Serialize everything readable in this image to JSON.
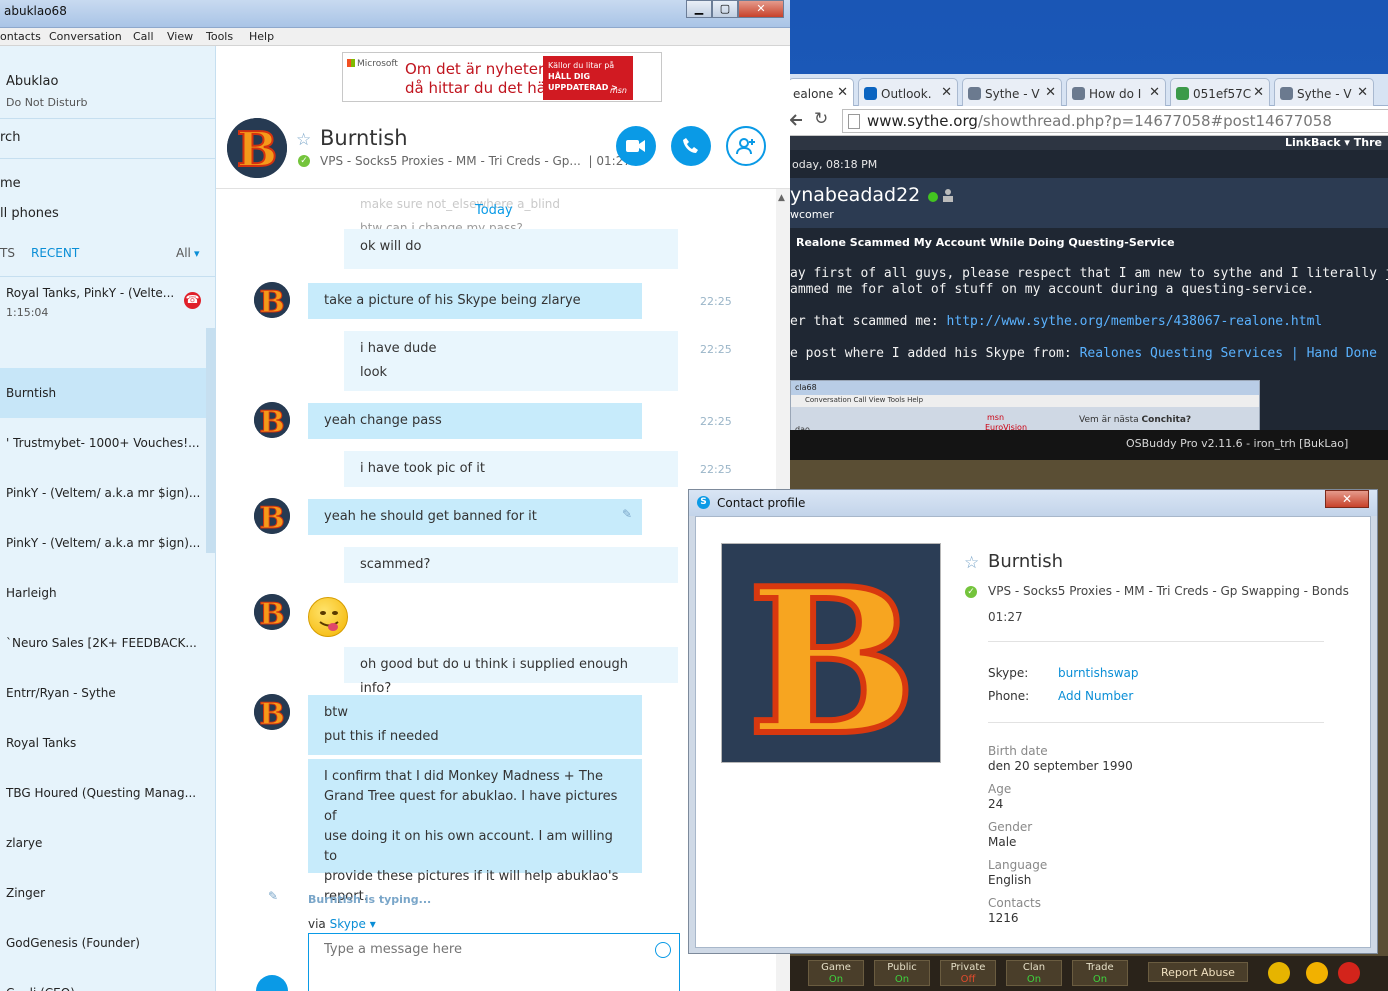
{
  "skype": {
    "window_title": "abuklao68",
    "menu": [
      "ontacts",
      "Conversation",
      "Call",
      "View",
      "Tools",
      "Help"
    ],
    "window_buttons": {
      "minimize": "▁",
      "maximize": "▢",
      "close": "✕"
    },
    "me": {
      "name": "Abuklao",
      "status": "Do Not Disturb"
    },
    "nav": {
      "search": "rch",
      "home": "me",
      "call_phones": "ll phones"
    },
    "tabs": {
      "contacts": "TS",
      "recent": "RECENT",
      "filter": "All"
    },
    "active_call": {
      "name": "Royal Tanks, PinkY - (Velte...",
      "duration": "1:15:04"
    },
    "recent": [
      "Burntish",
      "' Trustmybet- 1000+ Vouches!...",
      "PinkY - (Veltem/ a.k.a mr $ign)...",
      "PinkY - (Veltem/ a.k.a mr $ign)...",
      "Harleigh",
      "`Neuro Sales [2K+ FEEDBACK...",
      "Entrr/Ryan - Sythe",
      "Royal Tanks",
      "TBG Houred (Questing Manag...",
      "zlarye",
      "Zinger",
      "GodGenesis (Founder)",
      "C... li (CEO)"
    ],
    "ad": {
      "brand": "Microsoft",
      "headline_1": "Om det är nyheter,",
      "headline_2": "då hittar du det här",
      "box_1": "Källor du litar på",
      "box_2": "HÅLL DIG UPPDATERAD >",
      "box_3": "msn"
    },
    "contact": {
      "name": "Burntish",
      "mood": "VPS - Socks5 Proxies - MM - Tri Creds - Gp...",
      "sep": "|",
      "local_time": "01:27"
    },
    "chat": {
      "day": "Today",
      "ghost_1": "make sure not_elsewhere a_blind",
      "ghost_2": "btw can i change my pass?",
      "messages": [
        {
          "lines": [
            "ok will do"
          ],
          "time": ""
        },
        {
          "lines": [
            "take a picture of his Skype being zlarye"
          ],
          "time": "22:25"
        },
        {
          "lines": [
            "i have dude",
            "look"
          ],
          "time": "22:25"
        },
        {
          "lines": [
            "yeah change pass"
          ],
          "time": "22:25"
        },
        {
          "lines": [
            "i have took pic of it"
          ],
          "time": "22:25"
        },
        {
          "lines": [
            "yeah he should get banned for it"
          ],
          "time": ""
        },
        {
          "lines": [
            "scammed?"
          ],
          "time": ""
        },
        {
          "lines": [
            "oh good but do u think i supplied enough info?"
          ],
          "time": ""
        },
        {
          "lines": [
            "btw",
            "put this if needed"
          ],
          "time": ""
        },
        {
          "lines": [
            "I confirm that I did Monkey Madness + The",
            "Grand Tree quest for abuklao. I have pictures of",
            "use doing it on his own account. I am willing to",
            "provide these pictures if it will help abuklao's",
            "report."
          ],
          "time": ""
        }
      ],
      "typing": "Burntish is typing...",
      "via_prefix": "via",
      "via_service": "Skype",
      "composer_placeholder": "Type a message here"
    }
  },
  "browser": {
    "tabs": [
      "ealone",
      "Outlook.",
      "Sythe - V",
      "How do I",
      "051ef57C",
      "Sythe - V"
    ],
    "url_domain": "www.sythe.org",
    "url_path": "/showthread.php?p=14677058#post14677058",
    "top_links": "LinkBack ▾  Thre",
    "post_time": "oday, 08:18 PM",
    "poster": "ynabeadad22",
    "rank": "wcomer",
    "thread_title": "Realone Scammed My Account While Doing Questing-Service",
    "post_line_1": "ay first of all guys, please respect that I am new to sythe and I literally just made this a",
    "post_line_2": "ammed me for alot of stuff on my account during a questing-service.",
    "post_line_3_label": "er that scammed me:",
    "post_line_3_link": "http://www.sythe.org/members/438067-realone.html",
    "post_line_4_label": "e post where I added his Skype from:",
    "post_line_4_link": "Realones Questing Services | Hand Done | Afforda",
    "nested": {
      "title": "cla68",
      "menu": "Conversation   Call   View   Tools   Help",
      "left_label": "dao",
      "ad_brand": "msn",
      "ad_sub": "EuroVision",
      "ad_text_prefix": "Vem är nästa",
      "ad_text_bold": "Conchita?"
    },
    "game_title": "OSBuddy Pro v2.11.6 - iron_trh [BukLao]",
    "game_buttons": [
      {
        "label": "Game",
        "state": "On"
      },
      {
        "label": "Public",
        "state": "On"
      },
      {
        "label": "Private",
        "state": "Off"
      },
      {
        "label": "Clan",
        "state": "On"
      },
      {
        "label": "Trade",
        "state": "On"
      }
    ],
    "report": "Report Abuse"
  },
  "profile": {
    "window_title": "Contact profile",
    "close": "✕",
    "name": "Burntish",
    "mood": "VPS - Socks5 Proxies - MM - Tri Creds - Gp Swapping - Bonds",
    "local_time": "01:27",
    "skype_label": "Skype:",
    "skype_value": "burntishswap",
    "phone_label": "Phone:",
    "phone_value": "Add Number",
    "birth_label": "Birth date",
    "birth_value": "den 20 september 1990",
    "age_label": "Age",
    "age_value": "24",
    "gender_label": "Gender",
    "gender_value": "Male",
    "language_label": "Language",
    "language_value": "English",
    "contacts_label": "Contacts",
    "contacts_value": "1216",
    "avatar_letter": "B"
  },
  "colors": {
    "skype_blue": "#0a9ae6",
    "bubble_in": "#c7ebfb",
    "bubble_out": "#e9f6fd",
    "desktop": "#1d5db8"
  }
}
